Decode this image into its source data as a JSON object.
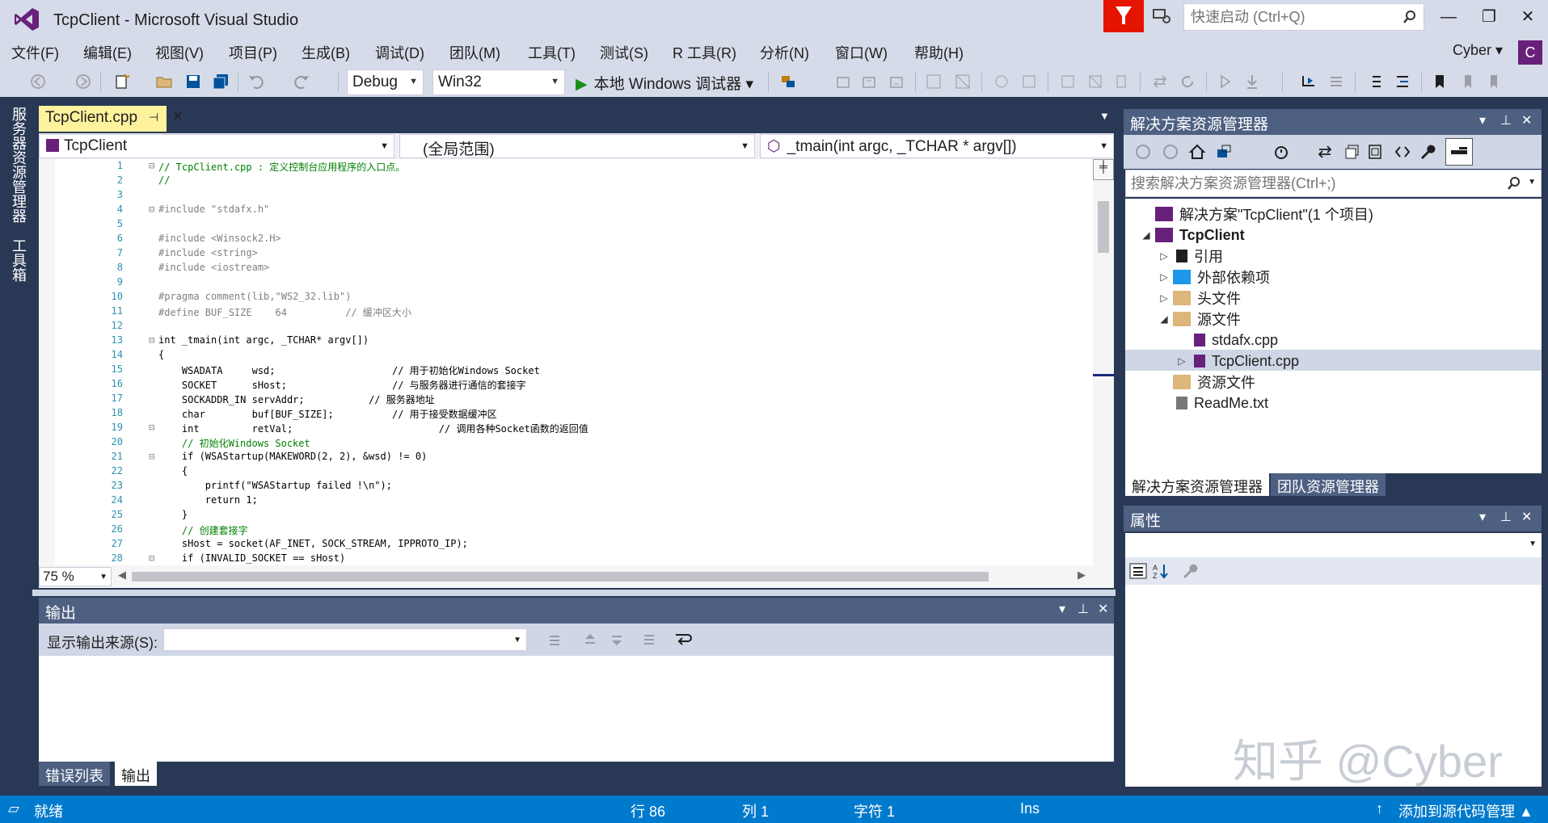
{
  "window": {
    "title": "TcpClient - Microsoft Visual Studio",
    "quick_launch_placeholder": "快速启动 (Ctrl+Q)",
    "min_glyph": "—",
    "max_glyph": "❐",
    "close_glyph": "✕"
  },
  "menu": [
    "文件(F)",
    "编辑(E)",
    "视图(V)",
    "项目(P)",
    "生成(B)",
    "调试(D)",
    "团队(M)",
    "工具(T)",
    "测试(S)",
    "R 工具(R)",
    "分析(N)",
    "窗口(W)",
    "帮助(H)"
  ],
  "user": {
    "name": "Cyber ▾",
    "initial": "C"
  },
  "toolbar": {
    "config": "Debug",
    "platform": "Win32",
    "debug_label": "本地 Windows 调试器 ▾"
  },
  "side_tabs": [
    "服务器资源管理器",
    "工具箱"
  ],
  "editor": {
    "tab_label": "TcpClient.cpp",
    "nav_project": "TcpClient",
    "nav_scope": "(全局范围)",
    "nav_member": "_tmain(int argc, _TCHAR * argv[])",
    "zoom": "75 %",
    "lines": [
      {
        "n": "1",
        "fold": "⊟",
        "text": "// TcpClient.cpp : 定义控制台应用程序的入口点。"
      },
      {
        "n": "2",
        "fold": "",
        "text": "//"
      },
      {
        "n": "3",
        "fold": "",
        "text": ""
      },
      {
        "n": "4",
        "fold": "⊟",
        "text": "#include \"stdafx.h\""
      },
      {
        "n": "5",
        "fold": "",
        "text": ""
      },
      {
        "n": "6",
        "fold": "",
        "text": "#include <Winsock2.H>"
      },
      {
        "n": "7",
        "fold": "",
        "text": "#include <string>"
      },
      {
        "n": "8",
        "fold": "",
        "text": "#include <iostream>"
      },
      {
        "n": "9",
        "fold": "",
        "text": ""
      },
      {
        "n": "10",
        "fold": "",
        "text": "#pragma comment(lib,\"WS2_32.lib\")"
      },
      {
        "n": "11",
        "fold": "",
        "text": "#define BUF_SIZE    64          // 缓冲区大小"
      },
      {
        "n": "12",
        "fold": "",
        "text": ""
      },
      {
        "n": "13",
        "fold": "⊟",
        "text": "int _tmain(int argc, _TCHAR* argv[])"
      },
      {
        "n": "14",
        "fold": "",
        "text": "{"
      },
      {
        "n": "15",
        "fold": "",
        "text": "    WSADATA     wsd;                    // 用于初始化Windows Socket"
      },
      {
        "n": "16",
        "fold": "",
        "text": "    SOCKET      sHost;                  // 与服务器进行通信的套接字"
      },
      {
        "n": "17",
        "fold": "",
        "text": "    SOCKADDR_IN servAddr;           // 服务器地址"
      },
      {
        "n": "18",
        "fold": "",
        "text": "    char        buf[BUF_SIZE];          // 用于接受数据缓冲区"
      },
      {
        "n": "19",
        "fold": "⊟",
        "text": "    int         retVal;                         // 调用各种Socket函数的返回值"
      },
      {
        "n": "20",
        "fold": "",
        "text": "    // 初始化Windows Socket"
      },
      {
        "n": "21",
        "fold": "⊟",
        "text": "    if (WSAStartup(MAKEWORD(2, 2), &wsd) != 0)"
      },
      {
        "n": "22",
        "fold": "",
        "text": "    {"
      },
      {
        "n": "23",
        "fold": "",
        "text": "        printf(\"WSAStartup failed !\\n\");"
      },
      {
        "n": "24",
        "fold": "",
        "text": "        return 1;"
      },
      {
        "n": "25",
        "fold": "",
        "text": "    }"
      },
      {
        "n": "26",
        "fold": "",
        "text": "    // 创建套接字"
      },
      {
        "n": "27",
        "fold": "",
        "text": "    sHost = socket(AF_INET, SOCK_STREAM, IPPROTO_IP);"
      },
      {
        "n": "28",
        "fold": "⊟",
        "text": "    if (INVALID_SOCKET == sHost)"
      }
    ]
  },
  "output": {
    "title": "输出",
    "source_label": "显示输出来源(S):",
    "tabs": [
      "错误列表",
      "输出"
    ]
  },
  "solution_explorer": {
    "title": "解决方案资源管理器",
    "search_placeholder": "搜索解决方案资源管理器(Ctrl+;)",
    "tree": [
      {
        "label": "解决方案\"TcpClient\"(1 个项目)",
        "exp": "",
        "icon": "solution-icon",
        "bold": false
      },
      {
        "label": "TcpClient",
        "exp": "◢",
        "icon": "project-icon",
        "bold": true
      },
      {
        "label": "引用",
        "exp": "▷",
        "icon": "references-icon",
        "bold": false
      },
      {
        "label": "外部依赖项",
        "exp": "▷",
        "icon": "external-deps-icon",
        "bold": false
      },
      {
        "label": "头文件",
        "exp": "▷",
        "icon": "folder-icon",
        "bold": false
      },
      {
        "label": "源文件",
        "exp": "◢",
        "icon": "folder-open-icon",
        "bold": false
      },
      {
        "label": "stdafx.cpp",
        "exp": "",
        "icon": "cpp-file-icon",
        "bold": false
      },
      {
        "label": "TcpClient.cpp",
        "exp": "▷",
        "icon": "cpp-file-icon",
        "bold": false
      },
      {
        "label": "资源文件",
        "exp": "",
        "icon": "folder-icon",
        "bold": false
      },
      {
        "label": "ReadMe.txt",
        "exp": "",
        "icon": "text-file-icon",
        "bold": false
      }
    ],
    "tabs": [
      "解决方案资源管理器",
      "团队资源管理器"
    ]
  },
  "properties": {
    "title": "属性"
  },
  "watermark": "知乎 @Cyber",
  "status": {
    "ready": "就绪",
    "line": "行 86",
    "col": "列 1",
    "char": "字符 1",
    "mode": "Ins",
    "source_control": "添加到源代码管理 ▲"
  },
  "colors": {
    "accent": "#007acc",
    "tab_active": "#fff29d",
    "panel_header": "#4d6082",
    "well": "#293955",
    "vs_purple": "#68217a"
  }
}
